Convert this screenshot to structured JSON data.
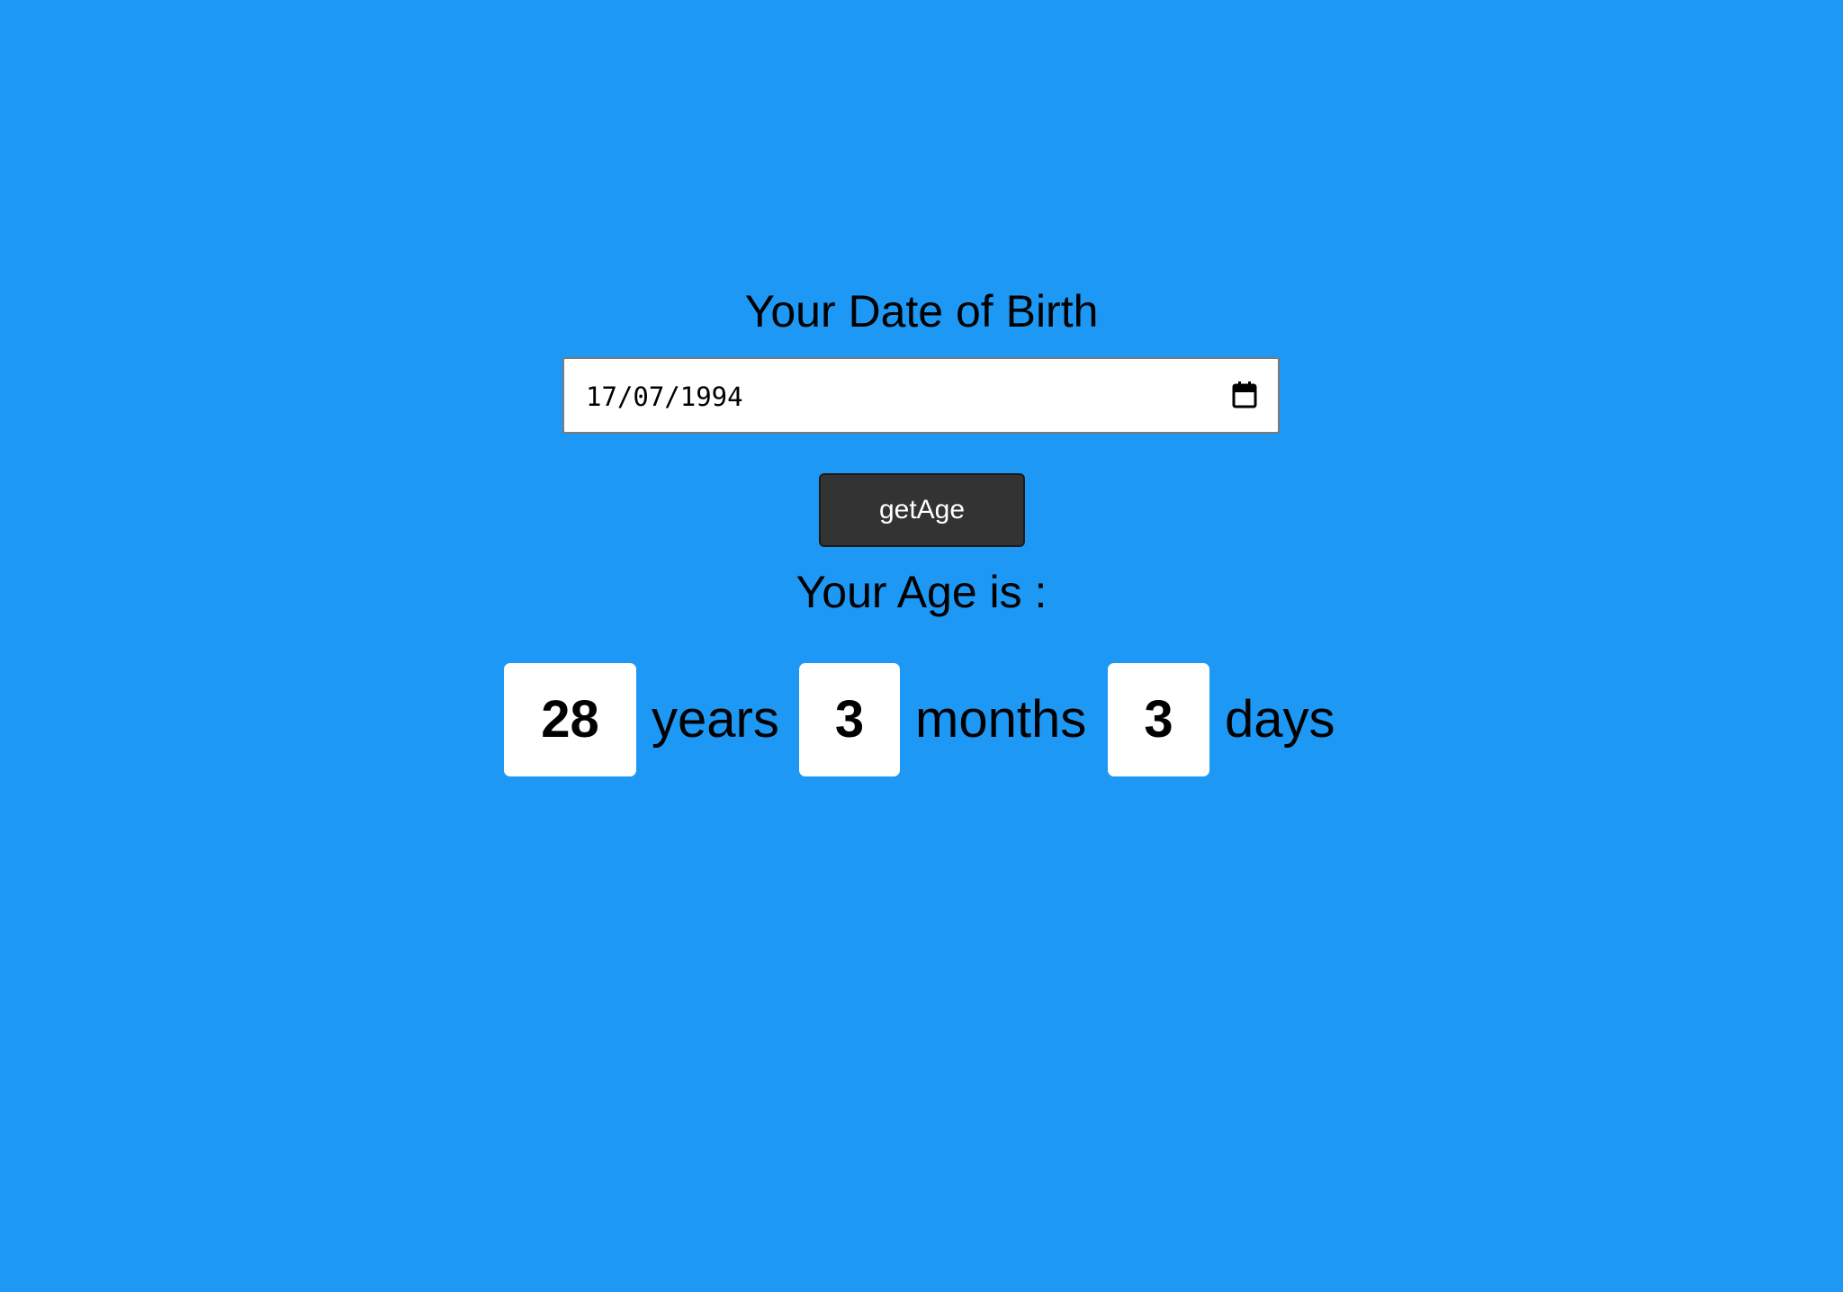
{
  "form": {
    "title": "Your Date of Birth",
    "date_value": "17/07/1994",
    "button_label": "getAge"
  },
  "result": {
    "heading": "Your Age is :",
    "years_value": "28",
    "years_label": "years",
    "months_value": "3",
    "months_label": "months",
    "days_value": "3",
    "days_label": "days"
  },
  "icons": {
    "calendar": "calendar-icon"
  },
  "colors": {
    "background": "#1e98f5",
    "button": "#333333",
    "box": "#ffffff"
  }
}
